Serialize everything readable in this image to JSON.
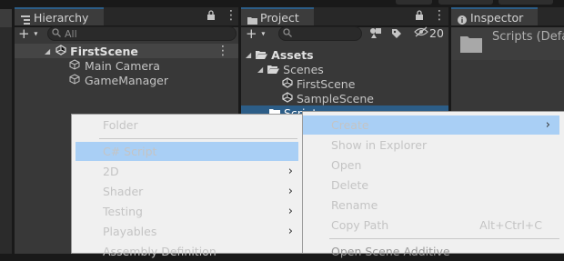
{
  "hierarchy": {
    "tab_label": "Hierarchy",
    "search_placeholder": "All",
    "scene_name": "FirstScene",
    "items": [
      "Main Camera",
      "GameManager"
    ]
  },
  "project": {
    "tab_label": "Project",
    "hidden_count": "20",
    "tree": [
      "Assets",
      "Scenes",
      "FirstScene",
      "SampleScene",
      "Scripts"
    ]
  },
  "inspector": {
    "tab_label": "Inspector",
    "title": "Scripts (Defa"
  },
  "create_menu": {
    "items": [
      "Folder",
      "C# Script",
      "2D",
      "Shader",
      "Testing",
      "Playables",
      "Assembly Definition"
    ]
  },
  "context_menu": {
    "items": [
      "Create",
      "Show in Explorer",
      "Open",
      "Delete",
      "Rename",
      "Copy Path",
      "Open Scene Additive"
    ],
    "copy_path_shortcut": "Alt+Ctrl+C"
  },
  "colors": {
    "selection": "#a9cff5",
    "menu_bg": "#f0f0f0",
    "panel_bg": "#383838"
  }
}
